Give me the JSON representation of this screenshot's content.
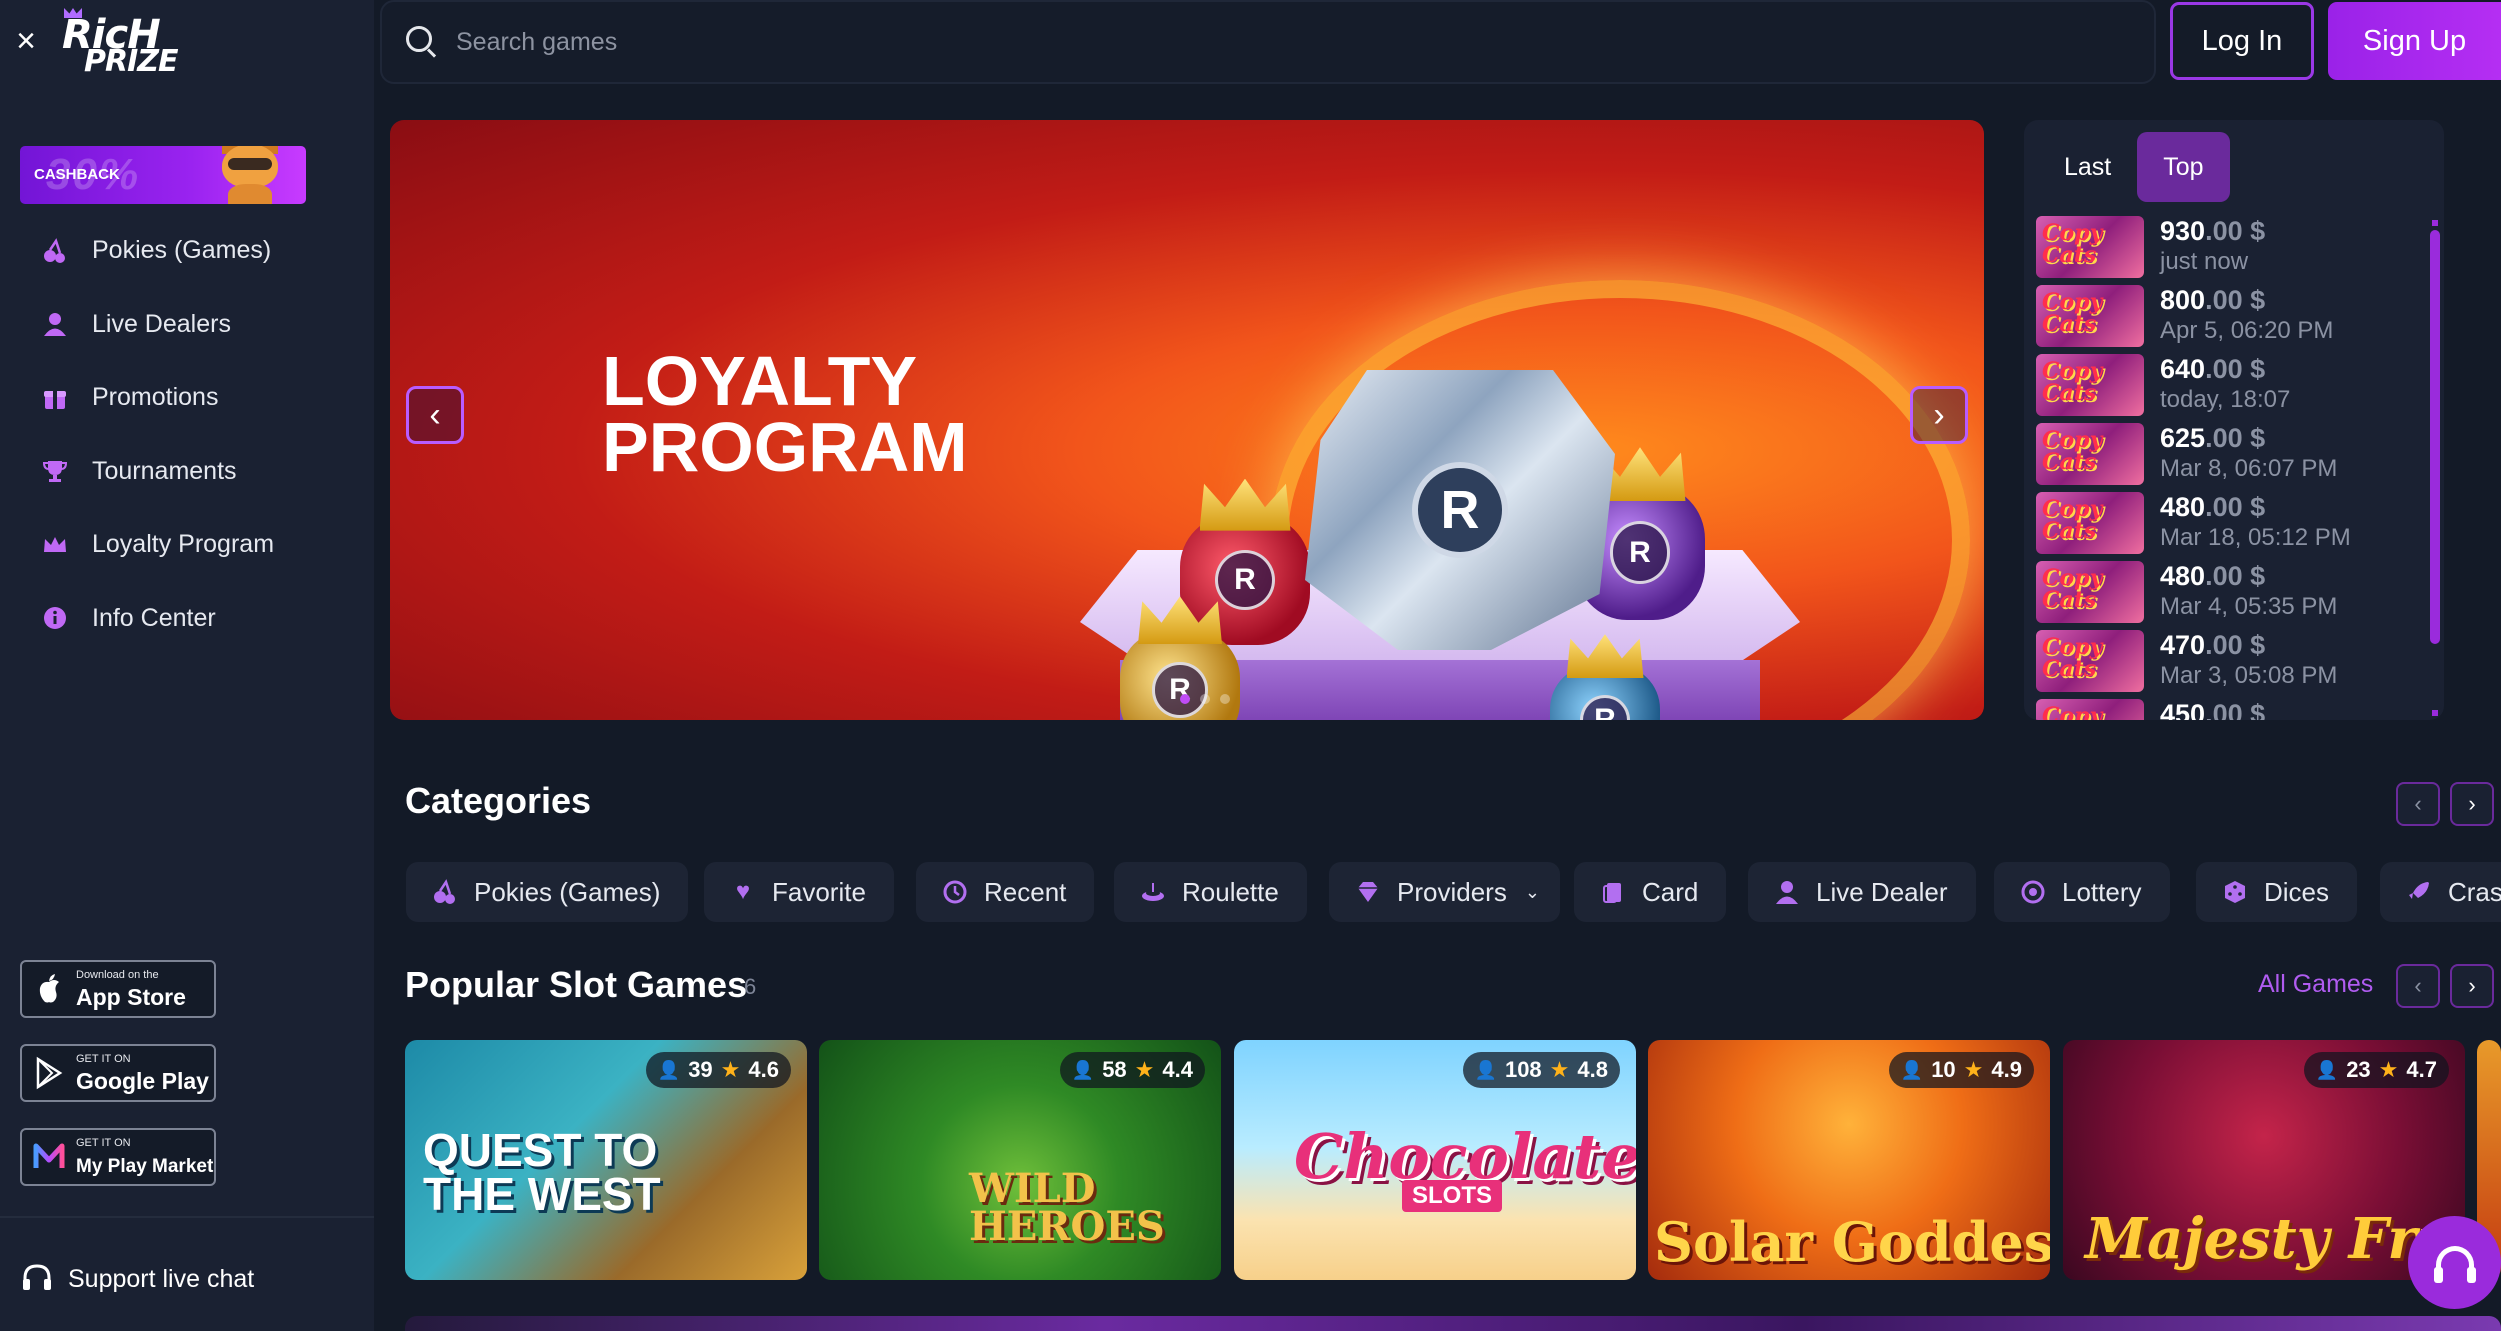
{
  "brand": {
    "logo_line1": "RicH",
    "logo_line2": "PRIZE"
  },
  "sidebar": {
    "close_label": "×",
    "cashback": {
      "label": "CASHBACK",
      "bg_text": "30%"
    },
    "items": [
      {
        "label": "Pokies (Games)",
        "icon": "cherries-icon"
      },
      {
        "label": "Live Dealers",
        "icon": "person-icon"
      },
      {
        "label": "Promotions",
        "icon": "gift-icon"
      },
      {
        "label": "Tournaments",
        "icon": "trophy-icon"
      },
      {
        "label": "Loyalty Program",
        "icon": "crown-icon"
      },
      {
        "label": "Info Center",
        "icon": "info-icon"
      }
    ],
    "stores": [
      {
        "small": "Download on the",
        "big": "App Store",
        "icon": "apple-icon"
      },
      {
        "small": "GET IT ON",
        "big": "Google Play",
        "icon": "google-play-icon"
      },
      {
        "small": "GET IT ON",
        "big": "My Play Market",
        "icon": "my-play-market-icon"
      }
    ],
    "support_label": "Support live chat"
  },
  "header": {
    "search_placeholder": "Search games",
    "login_label": "Log In",
    "signup_label": "Sign Up"
  },
  "banner": {
    "title_line1": "LOYALTY",
    "title_line2": "PROGRAM",
    "prev": "‹",
    "next": "›",
    "slides": 3,
    "active_slide": 1
  },
  "winners": {
    "tabs": [
      "Last",
      "Top"
    ],
    "active_tab": "Top",
    "rows": [
      {
        "game": "Copy Cats",
        "amount_int": "930",
        "amount_dec": ".00 $",
        "time": "just now"
      },
      {
        "game": "Copy Cats",
        "amount_int": "800",
        "amount_dec": ".00 $",
        "time": "Apr 5, 06:20 PM"
      },
      {
        "game": "Copy Cats",
        "amount_int": "640",
        "amount_dec": ".00 $",
        "time": "today, 18:07"
      },
      {
        "game": "Copy Cats",
        "amount_int": "625",
        "amount_dec": ".00 $",
        "time": "Mar 8, 06:07 PM"
      },
      {
        "game": "Copy Cats",
        "amount_int": "480",
        "amount_dec": ".00 $",
        "time": "Mar 18, 05:12 PM"
      },
      {
        "game": "Copy Cats",
        "amount_int": "480",
        "amount_dec": ".00 $",
        "time": "Mar 4, 05:35 PM"
      },
      {
        "game": "Copy Cats",
        "amount_int": "470",
        "amount_dec": ".00 $",
        "time": "Mar 3, 05:08 PM"
      },
      {
        "game": "Copy Cats",
        "amount_int": "450",
        "amount_dec": ".00 $",
        "time": ""
      }
    ]
  },
  "categories": {
    "title": "Categories",
    "items": [
      {
        "label": "Pokies (Games)",
        "icon": "cherries-icon"
      },
      {
        "label": "Favorite",
        "icon": "heart-icon"
      },
      {
        "label": "Recent",
        "icon": "history-icon"
      },
      {
        "label": "Roulette",
        "icon": "roulette-icon"
      },
      {
        "label": "Providers",
        "icon": "diamond-icon",
        "dropdown": true
      },
      {
        "label": "Card",
        "icon": "cards-icon"
      },
      {
        "label": "Live Dealer",
        "icon": "person-icon"
      },
      {
        "label": "Lottery",
        "icon": "lottery-icon"
      },
      {
        "label": "Dices",
        "icon": "dice-icon"
      },
      {
        "label": "Crash",
        "icon": "rocket-icon"
      }
    ]
  },
  "popular": {
    "title": "Popular Slot Games",
    "count": "6",
    "all_label": "All Games",
    "games": [
      {
        "title": "QUEST TO THE WEST",
        "players": "39",
        "rating": "4.6"
      },
      {
        "title": "WILD HEROES",
        "players": "58",
        "rating": "4.4"
      },
      {
        "title": "Chocolate",
        "subtitle": "SLOTS",
        "players": "108",
        "rating": "4.8"
      },
      {
        "title": "Solar Goddess",
        "players": "10",
        "rating": "4.9"
      },
      {
        "title": "Majesty Fruits",
        "players": "23",
        "rating": "4.7"
      }
    ]
  },
  "colors": {
    "accent": "#9a2bdc",
    "bg": "#131a27",
    "panel": "#1a2132",
    "star": "#ffb21a"
  }
}
